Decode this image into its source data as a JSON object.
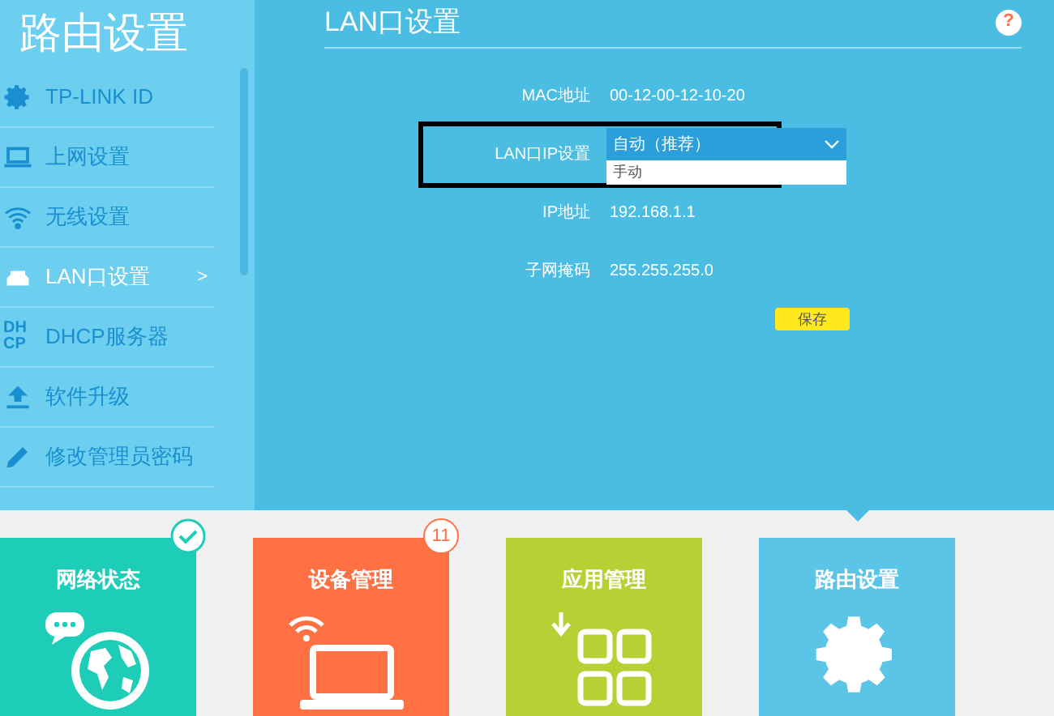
{
  "sidebar": {
    "title": "路由设置",
    "items": [
      {
        "kind": "gear",
        "label": "TP-LINK ID",
        "selected": false
      },
      {
        "kind": "laptop",
        "label": "上网设置",
        "selected": false
      },
      {
        "kind": "wifi",
        "label": "无线设置",
        "selected": false
      },
      {
        "kind": "lan",
        "label": "LAN口设置",
        "selected": true,
        "arrow": ">"
      },
      {
        "kind": "dhcp",
        "label": "DHCP服务器",
        "selected": false,
        "icon_text": [
          "DH",
          "CP"
        ]
      },
      {
        "kind": "upload",
        "label": "软件升级",
        "selected": false
      },
      {
        "kind": "pencil",
        "label": "修改管理员密码",
        "selected": false
      }
    ]
  },
  "main": {
    "title": "LAN口设置",
    "help": "?",
    "fields": [
      {
        "kind": "text",
        "label": "MAC地址",
        "value": "00-12-00-12-10-20"
      },
      {
        "kind": "dropdown",
        "label": "LAN口IP设置",
        "value": "自动（推荐）",
        "options": [
          "手动"
        ],
        "highlighted": true
      },
      {
        "kind": "text",
        "label": "IP地址",
        "value": "192.168.1.1"
      },
      {
        "kind": "text",
        "label": "子网掩码",
        "value": "255.255.255.0"
      }
    ],
    "save": "保存"
  },
  "tiles": [
    {
      "kind": "globe",
      "label": "网络状态",
      "color": "#1ecdb7",
      "badge": {
        "kind": "check"
      },
      "selected": false
    },
    {
      "kind": "laptop",
      "label": "设备管理",
      "color": "#ff7043",
      "badge": {
        "kind": "count",
        "text": "11"
      },
      "selected": false
    },
    {
      "kind": "apps",
      "label": "应用管理",
      "color": "#b5d133",
      "selected": false
    },
    {
      "kind": "gear",
      "label": "路由设置",
      "color": "#5bc5e8",
      "selected": true
    }
  ]
}
